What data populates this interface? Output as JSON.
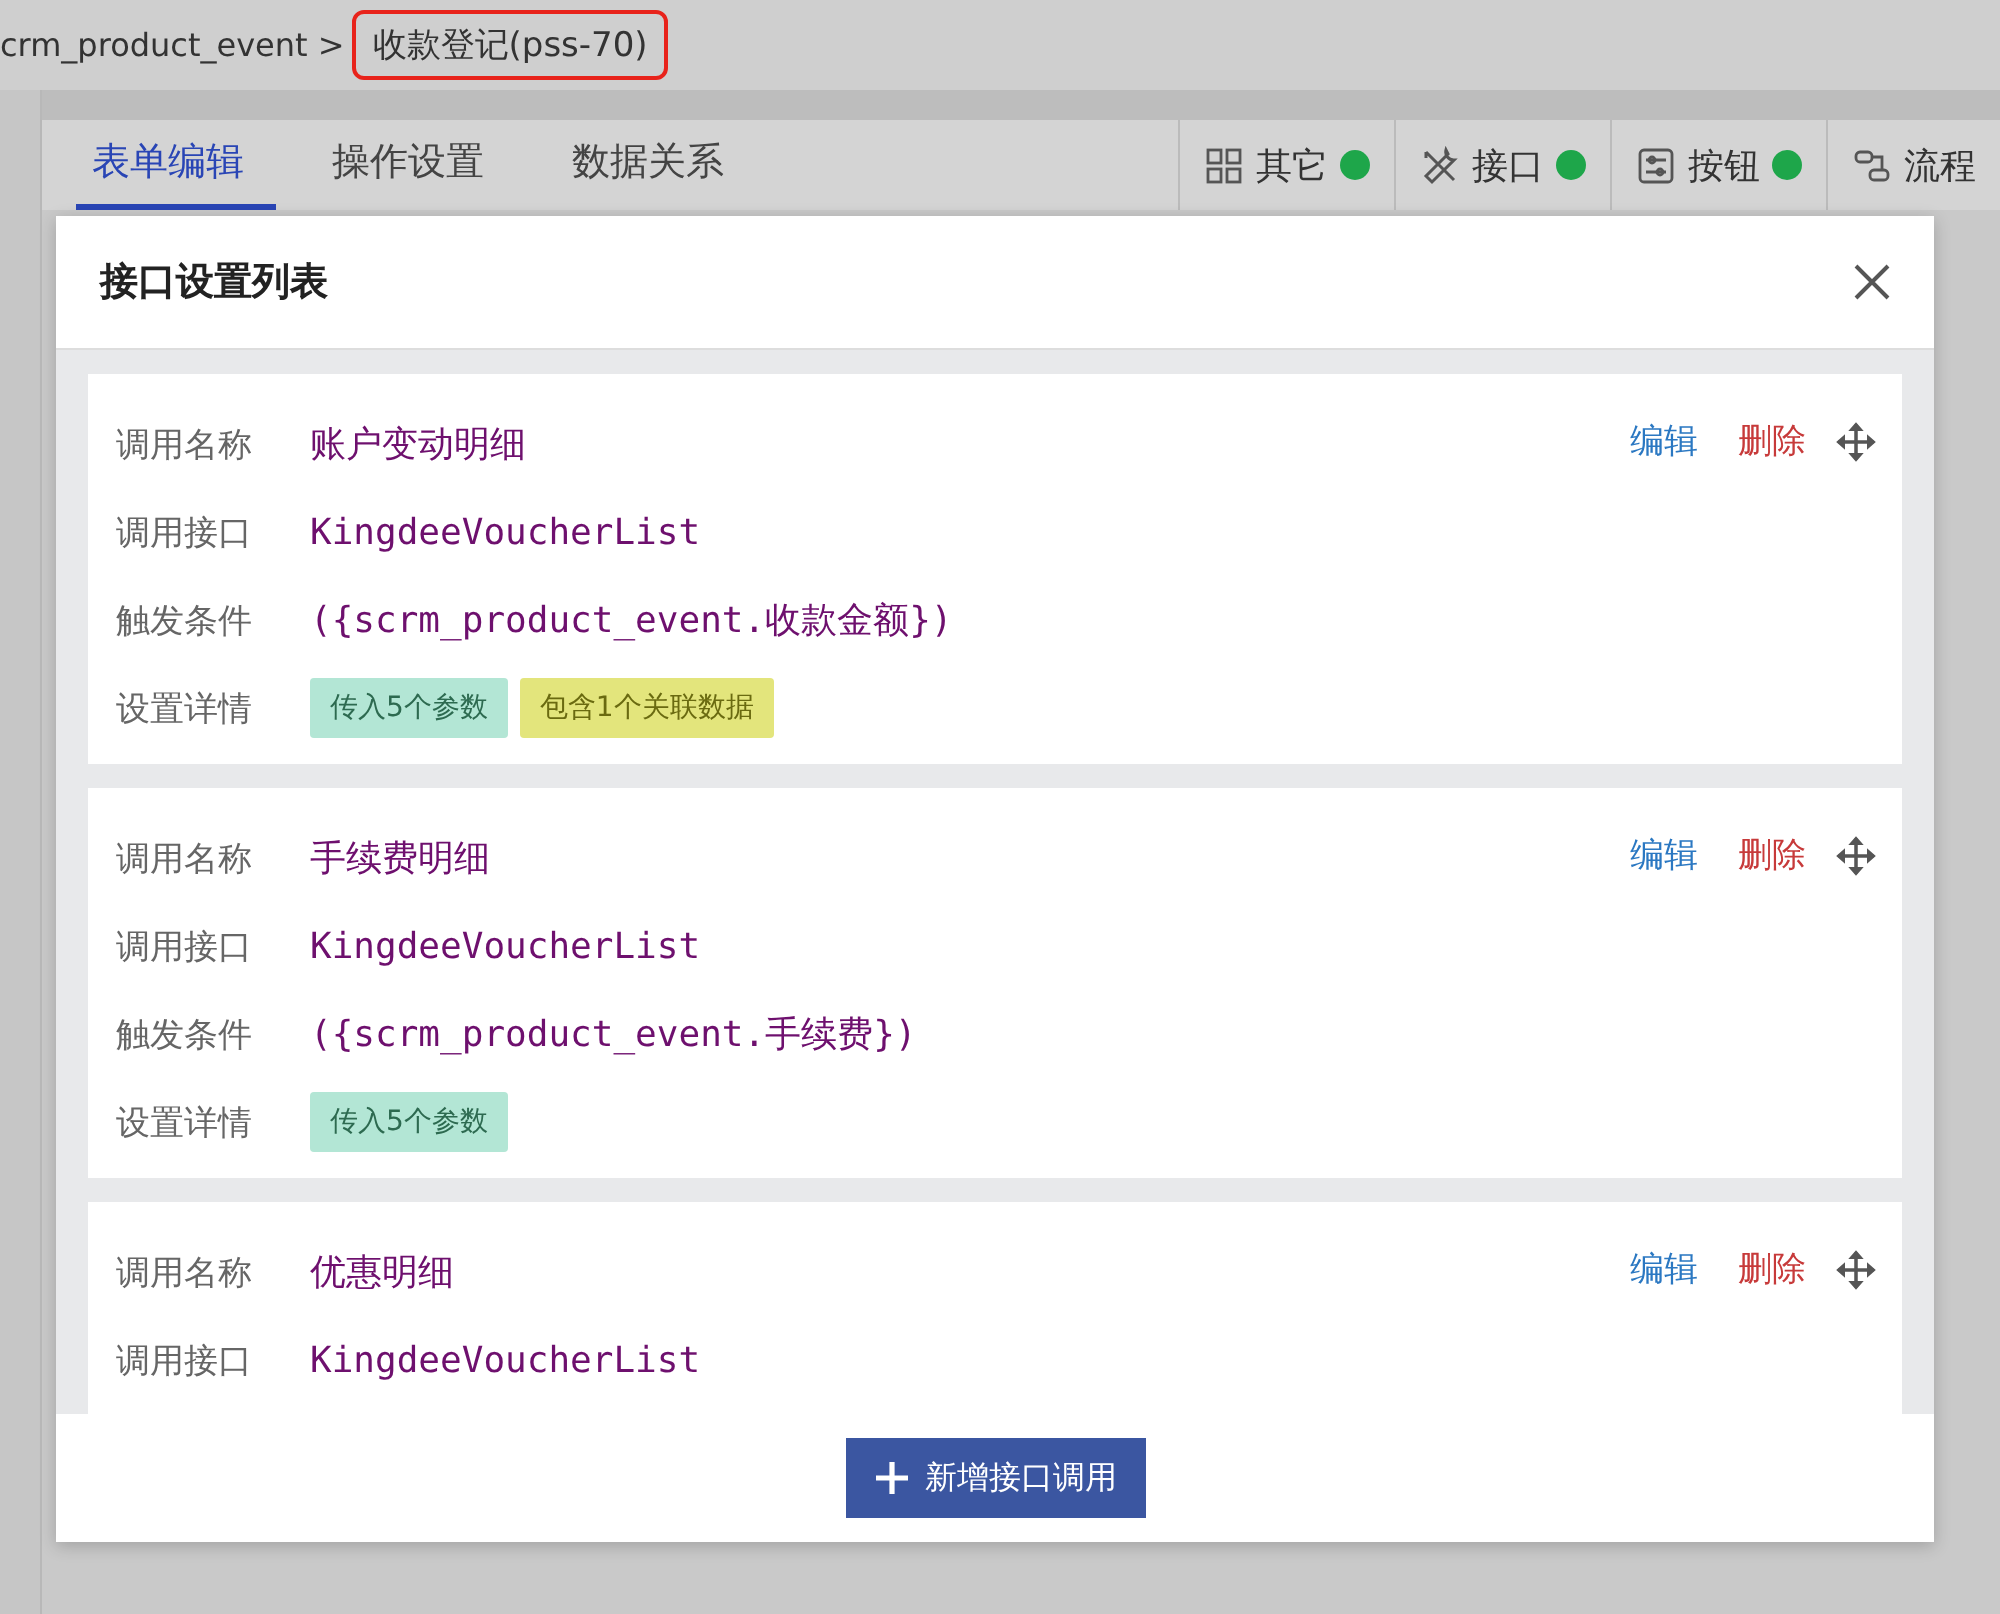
{
  "breadcrumb": {
    "parent": "crm_product_event >",
    "current": "收款登记(pss-70)"
  },
  "tabs": [
    {
      "label": "表单编辑",
      "selected": true
    },
    {
      "label": "操作设置",
      "selected": false
    },
    {
      "label": "数据关系",
      "selected": false
    }
  ],
  "toolbar": [
    {
      "kind": "grid",
      "label": "其它",
      "on": true
    },
    {
      "kind": "tools",
      "label": "接口",
      "on": true
    },
    {
      "kind": "panel",
      "label": "按钮",
      "on": true
    },
    {
      "kind": "flow",
      "label": "流程"
    }
  ],
  "dialog": {
    "title": "接口设置列表",
    "calls": [
      {
        "fields": [
          {
            "label": "调用名称",
            "value": "账户变动明细"
          },
          {
            "label": "调用接口",
            "value": "KingdeeVoucherList"
          },
          {
            "label": "触发条件",
            "value": "({scrm_product_event.收款金额})"
          }
        ],
        "details_label": "设置详情",
        "tags": [
          {
            "kind": "params",
            "text": "传入5个参数"
          },
          {
            "kind": "relation",
            "text": "包含1个关联数据"
          }
        ],
        "edit": "编辑",
        "delete": "删除"
      },
      {
        "fields": [
          {
            "label": "调用名称",
            "value": "手续费明细"
          },
          {
            "label": "调用接口",
            "value": "KingdeeVoucherList"
          },
          {
            "label": "触发条件",
            "value": "({scrm_product_event.手续费})"
          }
        ],
        "details_label": "设置详情",
        "tags": [
          {
            "kind": "params",
            "text": "传入5个参数"
          }
        ],
        "edit": "编辑",
        "delete": "删除"
      },
      {
        "fields": [
          {
            "label": "调用名称",
            "value": "优惠明细"
          },
          {
            "label": "调用接口",
            "value": "KingdeeVoucherList"
          }
        ],
        "edit": "编辑",
        "delete": "删除"
      }
    ],
    "add_button": "新增接口调用"
  }
}
